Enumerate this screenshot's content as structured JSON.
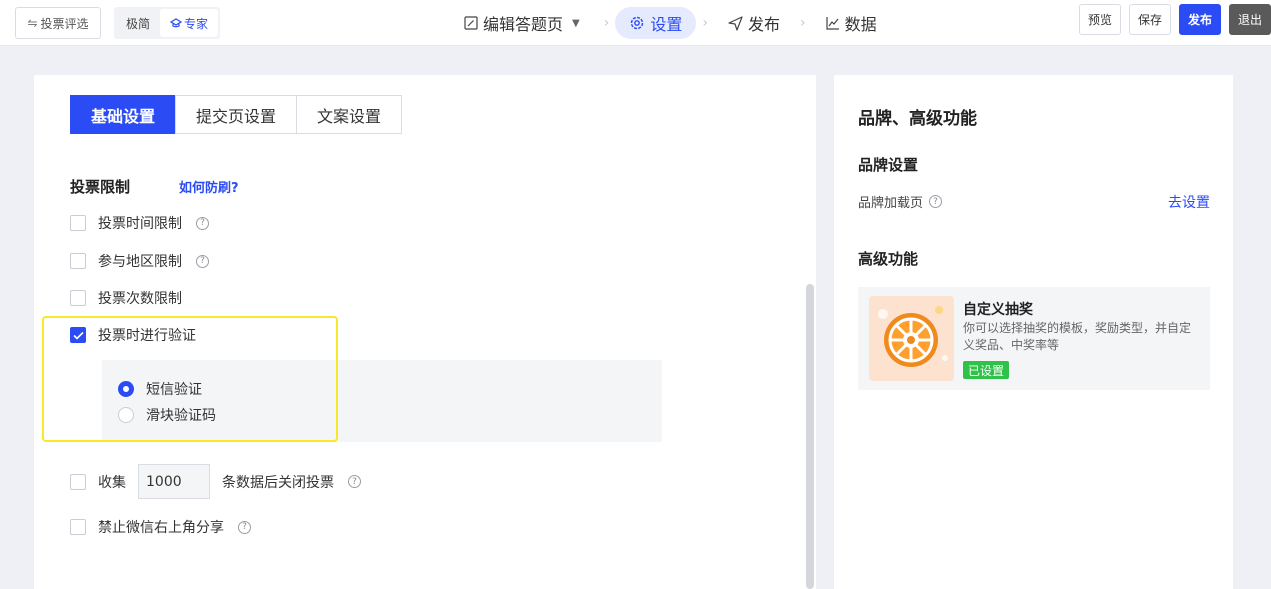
{
  "topbar": {
    "back_label": "投票评选",
    "modes": [
      "极简",
      "专家"
    ],
    "steps": [
      "编辑答题页",
      "设置",
      "发布",
      "数据"
    ],
    "actions": {
      "preview": "预览",
      "save": "保存",
      "publish": "发布",
      "exit": "退出"
    },
    "accent": "#2b4cf5"
  },
  "main": {
    "tabs": [
      "基础设置",
      "提交页设置",
      "文案设置"
    ],
    "section_title": "投票限制",
    "section_link": "如何防刷?",
    "options": [
      {
        "label": "投票时间限制",
        "checked": false,
        "help": true
      },
      {
        "label": "参与地区限制",
        "checked": false,
        "help": true
      },
      {
        "label": "投票次数限制",
        "checked": false,
        "help": false
      },
      {
        "label": "投票时进行验证",
        "checked": true,
        "help": false
      }
    ],
    "verify_methods": [
      {
        "label": "短信验证",
        "selected": true
      },
      {
        "label": "滑块验证码",
        "selected": false
      }
    ],
    "collect": {
      "prefix": "收集",
      "value": "1000",
      "suffix": "条数据后关闭投票",
      "checked": false
    },
    "share_block": {
      "label": "禁止微信右上角分享",
      "checked": false
    }
  },
  "right": {
    "title": "品牌、高级功能",
    "brand_heading": "品牌设置",
    "brand_row_label": "品牌加载页",
    "brand_row_link": "去设置",
    "advanced_heading": "高级功能",
    "card": {
      "title": "自定义抽奖",
      "desc": "你可以选择抽奖的模板，奖励类型，并自定义奖品、中奖率等",
      "badge": "已设置",
      "badge_color": "#2ec248"
    }
  }
}
